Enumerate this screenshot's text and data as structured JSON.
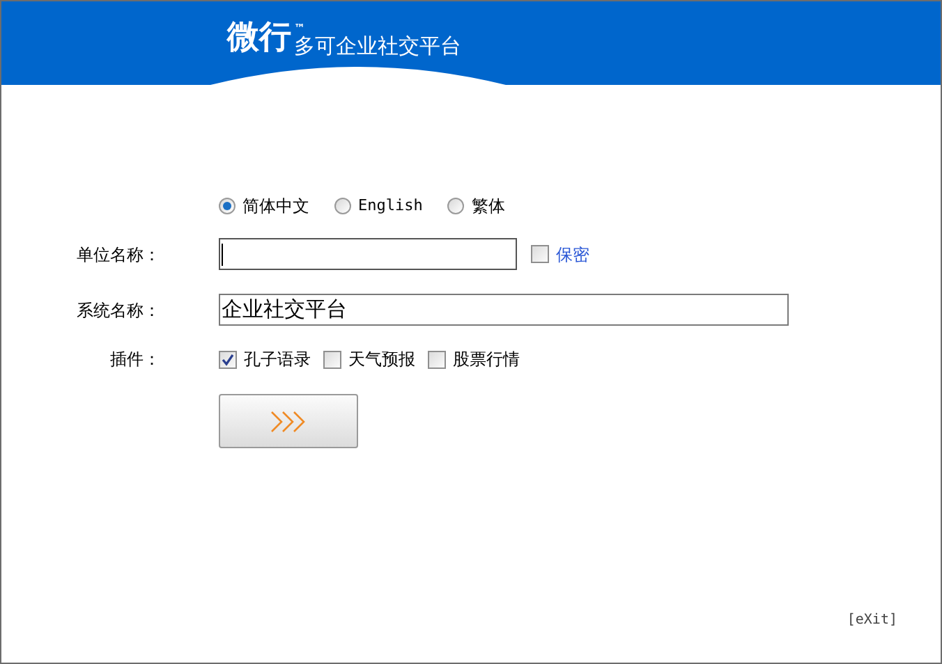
{
  "header": {
    "logo": "微行",
    "trademark": "™",
    "tagline": "多可企业社交平台"
  },
  "languages": [
    {
      "label": "简体中文",
      "selected": true
    },
    {
      "label": "English",
      "selected": false
    },
    {
      "label": "繁体",
      "selected": false
    }
  ],
  "fields": [
    {
      "label": "单位名称：",
      "focused": true,
      "secret": {
        "label": "保密",
        "checked": false
      }
    },
    {
      "label": "系统名称：",
      "value": "企业社交平台",
      "focused": false
    }
  ],
  "plugins": {
    "label": "插件：",
    "items": [
      {
        "label": "孔子语录",
        "checked": true
      },
      {
        "label": "天气预报",
        "checked": false
      },
      {
        "label": "股票行情",
        "checked": false
      }
    ]
  },
  "exit": "[eXit]"
}
